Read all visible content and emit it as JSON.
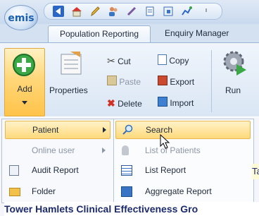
{
  "app": {
    "logo_text": "emis"
  },
  "tabs": [
    {
      "label": "Population Reporting"
    },
    {
      "label": "Enquiry Manager"
    }
  ],
  "ribbon": {
    "add_label": "Add",
    "properties_label": "Properties",
    "cut_label": "Cut",
    "paste_label": "Paste",
    "delete_label": "Delete",
    "copy_label": "Copy",
    "export_label": "Export",
    "import_label": "Import",
    "run_label": "Run"
  },
  "add_menu": {
    "items": [
      {
        "label": "Patient",
        "icon": "patient-icon"
      },
      {
        "label": "Online user",
        "icon": "online-user-icon"
      },
      {
        "label": "Audit Report",
        "icon": "audit-report-icon"
      },
      {
        "label": "Folder",
        "icon": "folder-icon"
      }
    ]
  },
  "patient_submenu": {
    "items": [
      {
        "label": "Search",
        "icon": "search-icon"
      },
      {
        "label": "List of Patients",
        "icon": "list-of-patients-icon"
      },
      {
        "label": "List Report",
        "icon": "list-report-icon"
      },
      {
        "label": "Aggregate Report",
        "icon": "aggregate-report-icon"
      }
    ]
  },
  "background": {
    "bottom_text": "Tower Hamlets Clinical Effectiveness Gro",
    "right_fragment": "Ta"
  },
  "colors": {
    "highlight": "#ffd97c",
    "ribbon": "#dae6f4",
    "accent": "#1b5fb0"
  }
}
